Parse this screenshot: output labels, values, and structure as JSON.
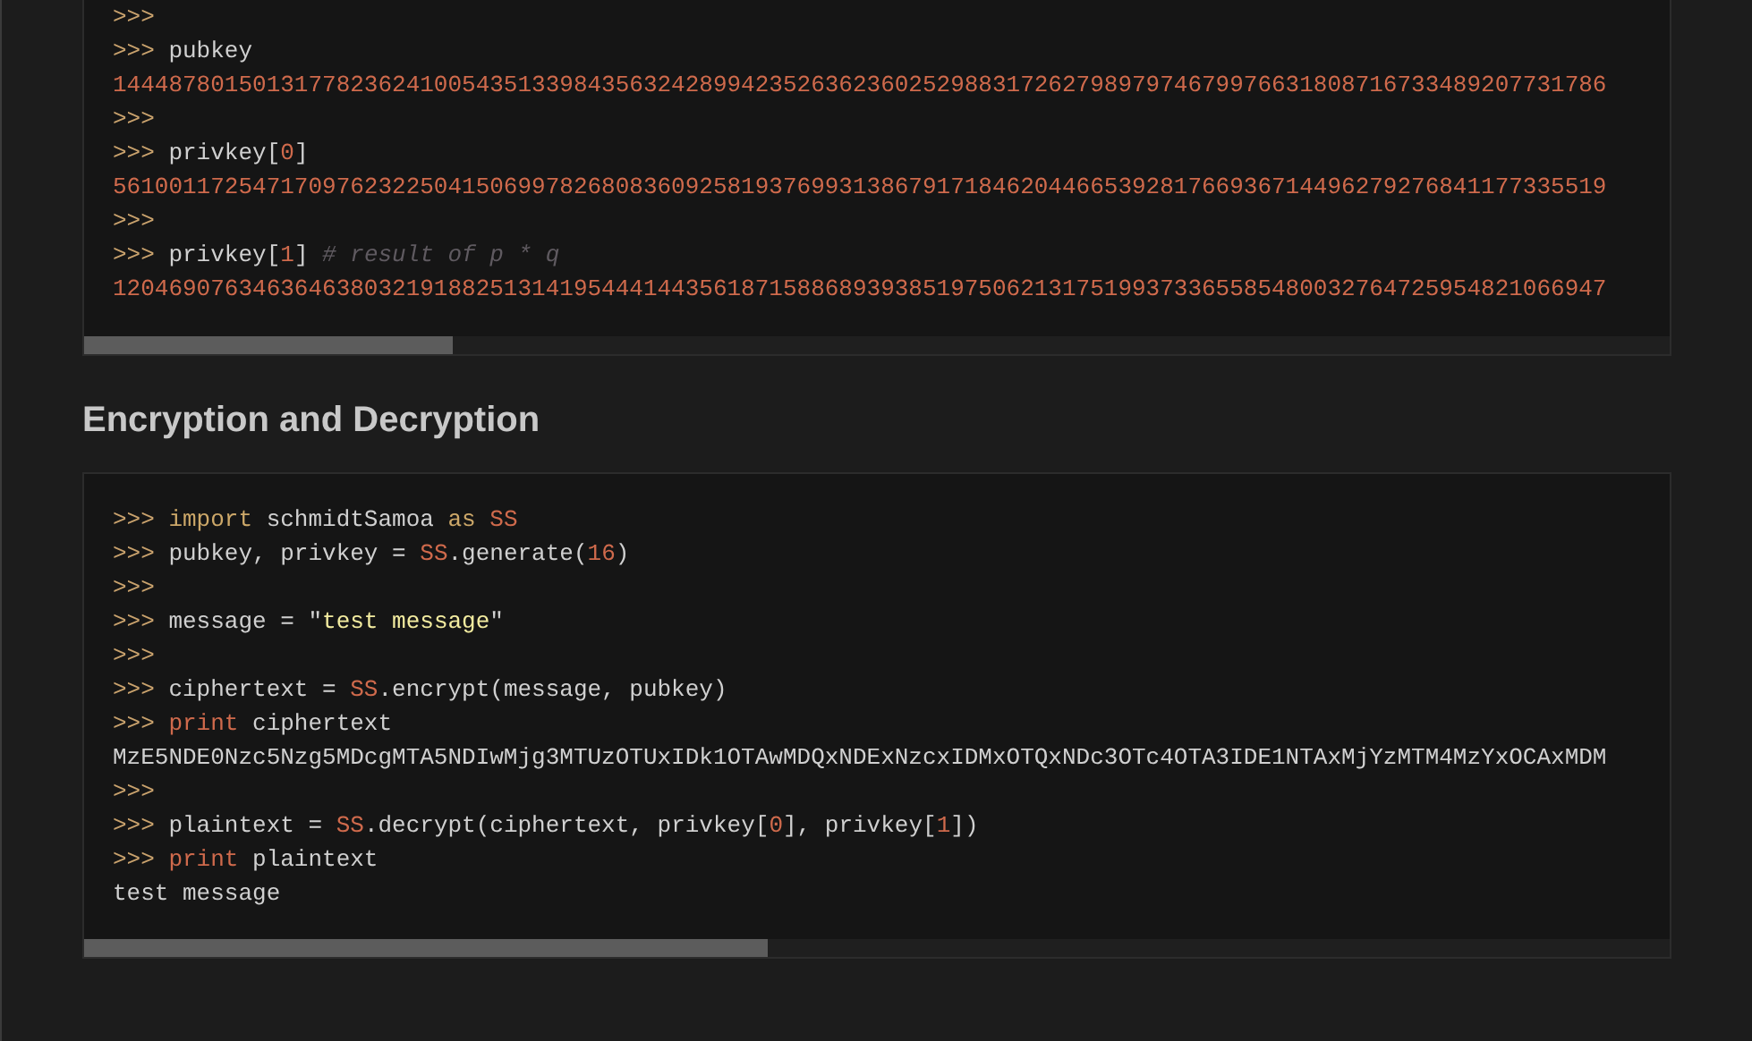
{
  "code_blocks": [
    {
      "lines": [
        [
          {
            "kind": "prompt",
            "text": ">>>"
          }
        ],
        [
          {
            "kind": "prompt",
            "text": ">>>"
          },
          {
            "kind": "plain",
            "text": " pubkey"
          }
        ],
        [
          {
            "kind": "number",
            "text": "14448780150131778236241005435133984356324289942352636236025298831726279897974679976631808716733489207731786"
          }
        ],
        [
          {
            "kind": "prompt",
            "text": ">>>"
          }
        ],
        [
          {
            "kind": "prompt",
            "text": ">>>"
          },
          {
            "kind": "plain",
            "text": " privkey["
          },
          {
            "kind": "number",
            "text": "0"
          },
          {
            "kind": "plain",
            "text": "]"
          }
        ],
        [
          {
            "kind": "number",
            "text": "56100117254717097623225041506997826808360925819376993138679171846204466539281766936714496279276841177335519"
          }
        ],
        [
          {
            "kind": "prompt",
            "text": ">>>"
          }
        ],
        [
          {
            "kind": "prompt",
            "text": ">>>"
          },
          {
            "kind": "plain",
            "text": " privkey["
          },
          {
            "kind": "number",
            "text": "1"
          },
          {
            "kind": "plain",
            "text": "] "
          },
          {
            "kind": "comment",
            "text": "# result of p * q"
          }
        ],
        [
          {
            "kind": "number",
            "text": "12046907634636463803219188251314195444144356187158868939385197506213175199373365585480032764725954821066947"
          }
        ]
      ]
    },
    {
      "heading": "Encryption and Decryption"
    },
    {
      "lines": [
        [
          {
            "kind": "prompt",
            "text": ">>>"
          },
          {
            "kind": "keyword",
            "text": " import"
          },
          {
            "kind": "plain",
            "text": " schmidtSamoa "
          },
          {
            "kind": "keyword",
            "text": "as"
          },
          {
            "kind": "number",
            "text": " SS"
          }
        ],
        [
          {
            "kind": "prompt",
            "text": ">>>"
          },
          {
            "kind": "plain",
            "text": " pubkey, privkey = "
          },
          {
            "kind": "number",
            "text": "SS"
          },
          {
            "kind": "plain",
            "text": ".generate("
          },
          {
            "kind": "number",
            "text": "16"
          },
          {
            "kind": "plain",
            "text": ")"
          }
        ],
        [
          {
            "kind": "prompt",
            "text": ">>>"
          }
        ],
        [
          {
            "kind": "prompt",
            "text": ">>>"
          },
          {
            "kind": "plain",
            "text": " message = \""
          },
          {
            "kind": "string",
            "text": "test message"
          },
          {
            "kind": "plain",
            "text": "\""
          }
        ],
        [
          {
            "kind": "prompt",
            "text": ">>>"
          }
        ],
        [
          {
            "kind": "prompt",
            "text": ">>>"
          },
          {
            "kind": "plain",
            "text": " ciphertext = "
          },
          {
            "kind": "number",
            "text": "SS"
          },
          {
            "kind": "plain",
            "text": ".encrypt(message, pubkey)"
          }
        ],
        [
          {
            "kind": "prompt",
            "text": ">>>"
          },
          {
            "kind": "builtin",
            "text": " print"
          },
          {
            "kind": "plain",
            "text": " ciphertext"
          }
        ],
        [
          {
            "kind": "plain",
            "text": "MzE5NDE0Nzc5Nzg5MDcgMTA5NDIwMjg3MTUzOTUxIDk1OTAwMDQxNDExNzcxIDMxOTQxNDc3OTc4OTA3IDE1NTAxMjYzMTM4MzYxOCAxMDM"
          }
        ],
        [
          {
            "kind": "prompt",
            "text": ">>>"
          }
        ],
        [
          {
            "kind": "prompt",
            "text": ">>>"
          },
          {
            "kind": "plain",
            "text": " plaintext = "
          },
          {
            "kind": "number",
            "text": "SS"
          },
          {
            "kind": "plain",
            "text": ".decrypt(ciphertext, privkey["
          },
          {
            "kind": "number",
            "text": "0"
          },
          {
            "kind": "plain",
            "text": "], privkey["
          },
          {
            "kind": "number",
            "text": "1"
          },
          {
            "kind": "plain",
            "text": "])"
          }
        ],
        [
          {
            "kind": "prompt",
            "text": ">>>"
          },
          {
            "kind": "builtin",
            "text": " print"
          },
          {
            "kind": "plain",
            "text": " plaintext"
          }
        ],
        [
          {
            "kind": "plain",
            "text": "test message"
          }
        ]
      ]
    }
  ]
}
